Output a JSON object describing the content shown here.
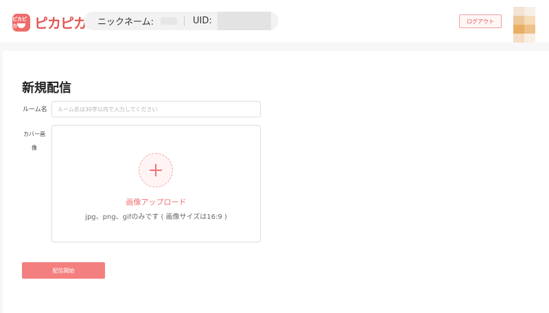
{
  "header": {
    "logo_badge": "ピカピカ",
    "logo_text": "ピカピカ",
    "nickname_label": "ニックネーム:",
    "uid_label": "UID:",
    "logout_label": "ログアウト"
  },
  "form": {
    "title": "新規配信",
    "room_name_label": "ルーム名",
    "room_name_placeholder": "ルーム名は30字以内で入力してください",
    "room_name_value": "",
    "cover_label": "カバー画像",
    "upload_label": "画像アップロード",
    "upload_hint": "jpg、png、gifのみです ( 画像サイズは16:9 )",
    "submit_label": "配信開始"
  },
  "colors": {
    "accent": "#f06b6b",
    "button": "#f47f7f"
  },
  "icons": {
    "logo": "pika-logo-icon",
    "upload": "plus-icon"
  }
}
